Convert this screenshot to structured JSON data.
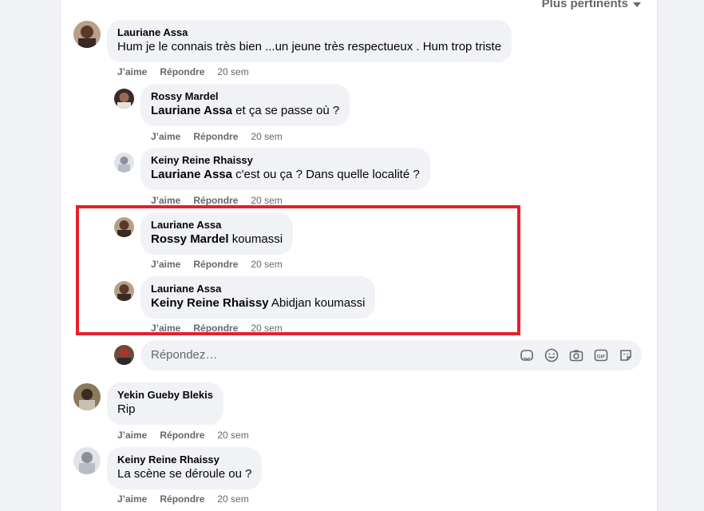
{
  "header": {
    "sort_label": "Plus pertinents"
  },
  "actions": {
    "like": "J’aime",
    "reply": "Répondre"
  },
  "comments": [
    {
      "author": "Lauriane Assa",
      "mention": "",
      "text": "Hum je le connais très bien ...un jeune très respectueux . Hum trop triste",
      "time": "20 sem"
    },
    {
      "author": "Rossy Mardel",
      "mention": "Lauriane Assa",
      "text": " et ça se passe où ?",
      "time": "20 sem"
    },
    {
      "author": "Keiny Reine Rhaissy",
      "mention": "Lauriane Assa",
      "text": " c'est ou ça ? Dans quelle localité ?",
      "time": "20 sem"
    },
    {
      "author": "Lauriane Assa",
      "mention": "Rossy Mardel",
      "text": " koumassi",
      "time": "20 sem"
    },
    {
      "author": "Lauriane Assa",
      "mention": "Keiny Reine Rhaissy",
      "text": " Abidjan koumassi",
      "time": "20 sem"
    },
    {
      "author": "Yekin Gueby Blekis",
      "mention": "",
      "text": "Rip",
      "time": "20 sem"
    },
    {
      "author": "Keiny Reine Rhaissy",
      "mention": "",
      "text": "La scène se déroule ou ?",
      "time": "20 sem"
    }
  ],
  "reply_box": {
    "placeholder": "Répondez…"
  },
  "icons": [
    "sticker-icon",
    "emoji-icon",
    "camera-icon",
    "gif-icon",
    "avatar-sticker-icon"
  ],
  "colors": {
    "highlight": "#e5202e",
    "bubble": "#f0f2f5",
    "secondary_text": "#65676b"
  }
}
